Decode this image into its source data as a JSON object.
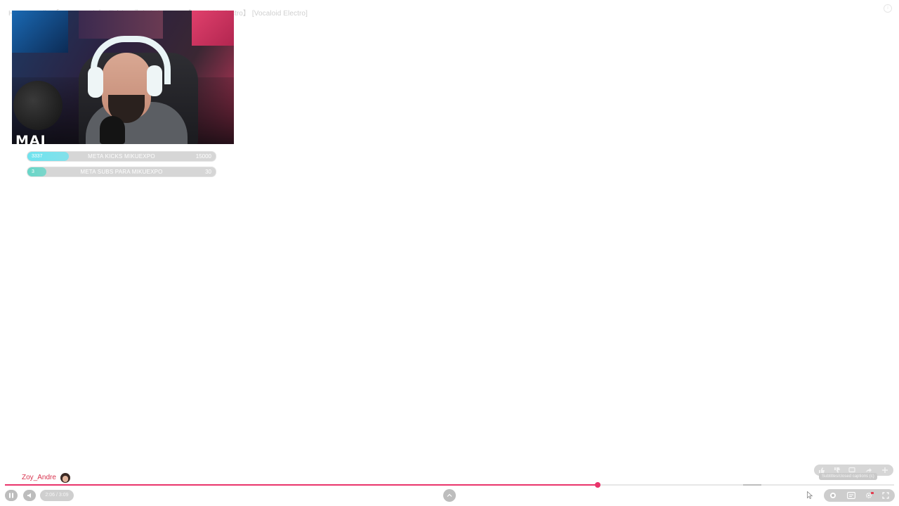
{
  "video": {
    "title": "Hatsune Miku「GHOST」(ゴースト) - 『Kimi ni Kaeru』【Vocaloid Electro】 [Vocaloid Electro]"
  },
  "webcam": {
    "logo_text": "MAI"
  },
  "goals": [
    {
      "current": "3337",
      "label": "META KICKS MIKUEXPO",
      "target": "15000",
      "progress_fraction": 0.22,
      "color": "#6fe3ef"
    },
    {
      "current": "3",
      "label": "META SUBS PARA MIKUEXPO",
      "target": "30",
      "progress_fraction": 0.1,
      "color": "#66d6c8"
    }
  ],
  "chat_user": {
    "name": "Zoy_Andre"
  },
  "player": {
    "time_display": "2:06 / 3:09",
    "progress_fraction": 0.667,
    "buffered_fraction": 0.83,
    "accent_color": "#e9346b",
    "captions_tooltip": "Subtitles/closed captions (c)",
    "icons": {
      "pause": "pause-icon",
      "volume": "volume-icon",
      "expand": "chevron-up-icon",
      "autoplay": "autoplay-icon",
      "subtitles": "subtitles-icon",
      "settings": "gear-icon",
      "fullscreen": "fullscreen-icon",
      "like": "thumbs-up-icon",
      "dislike": "thumbs-down-icon",
      "comment": "comment-icon",
      "share": "share-icon",
      "more": "more-icon"
    }
  }
}
